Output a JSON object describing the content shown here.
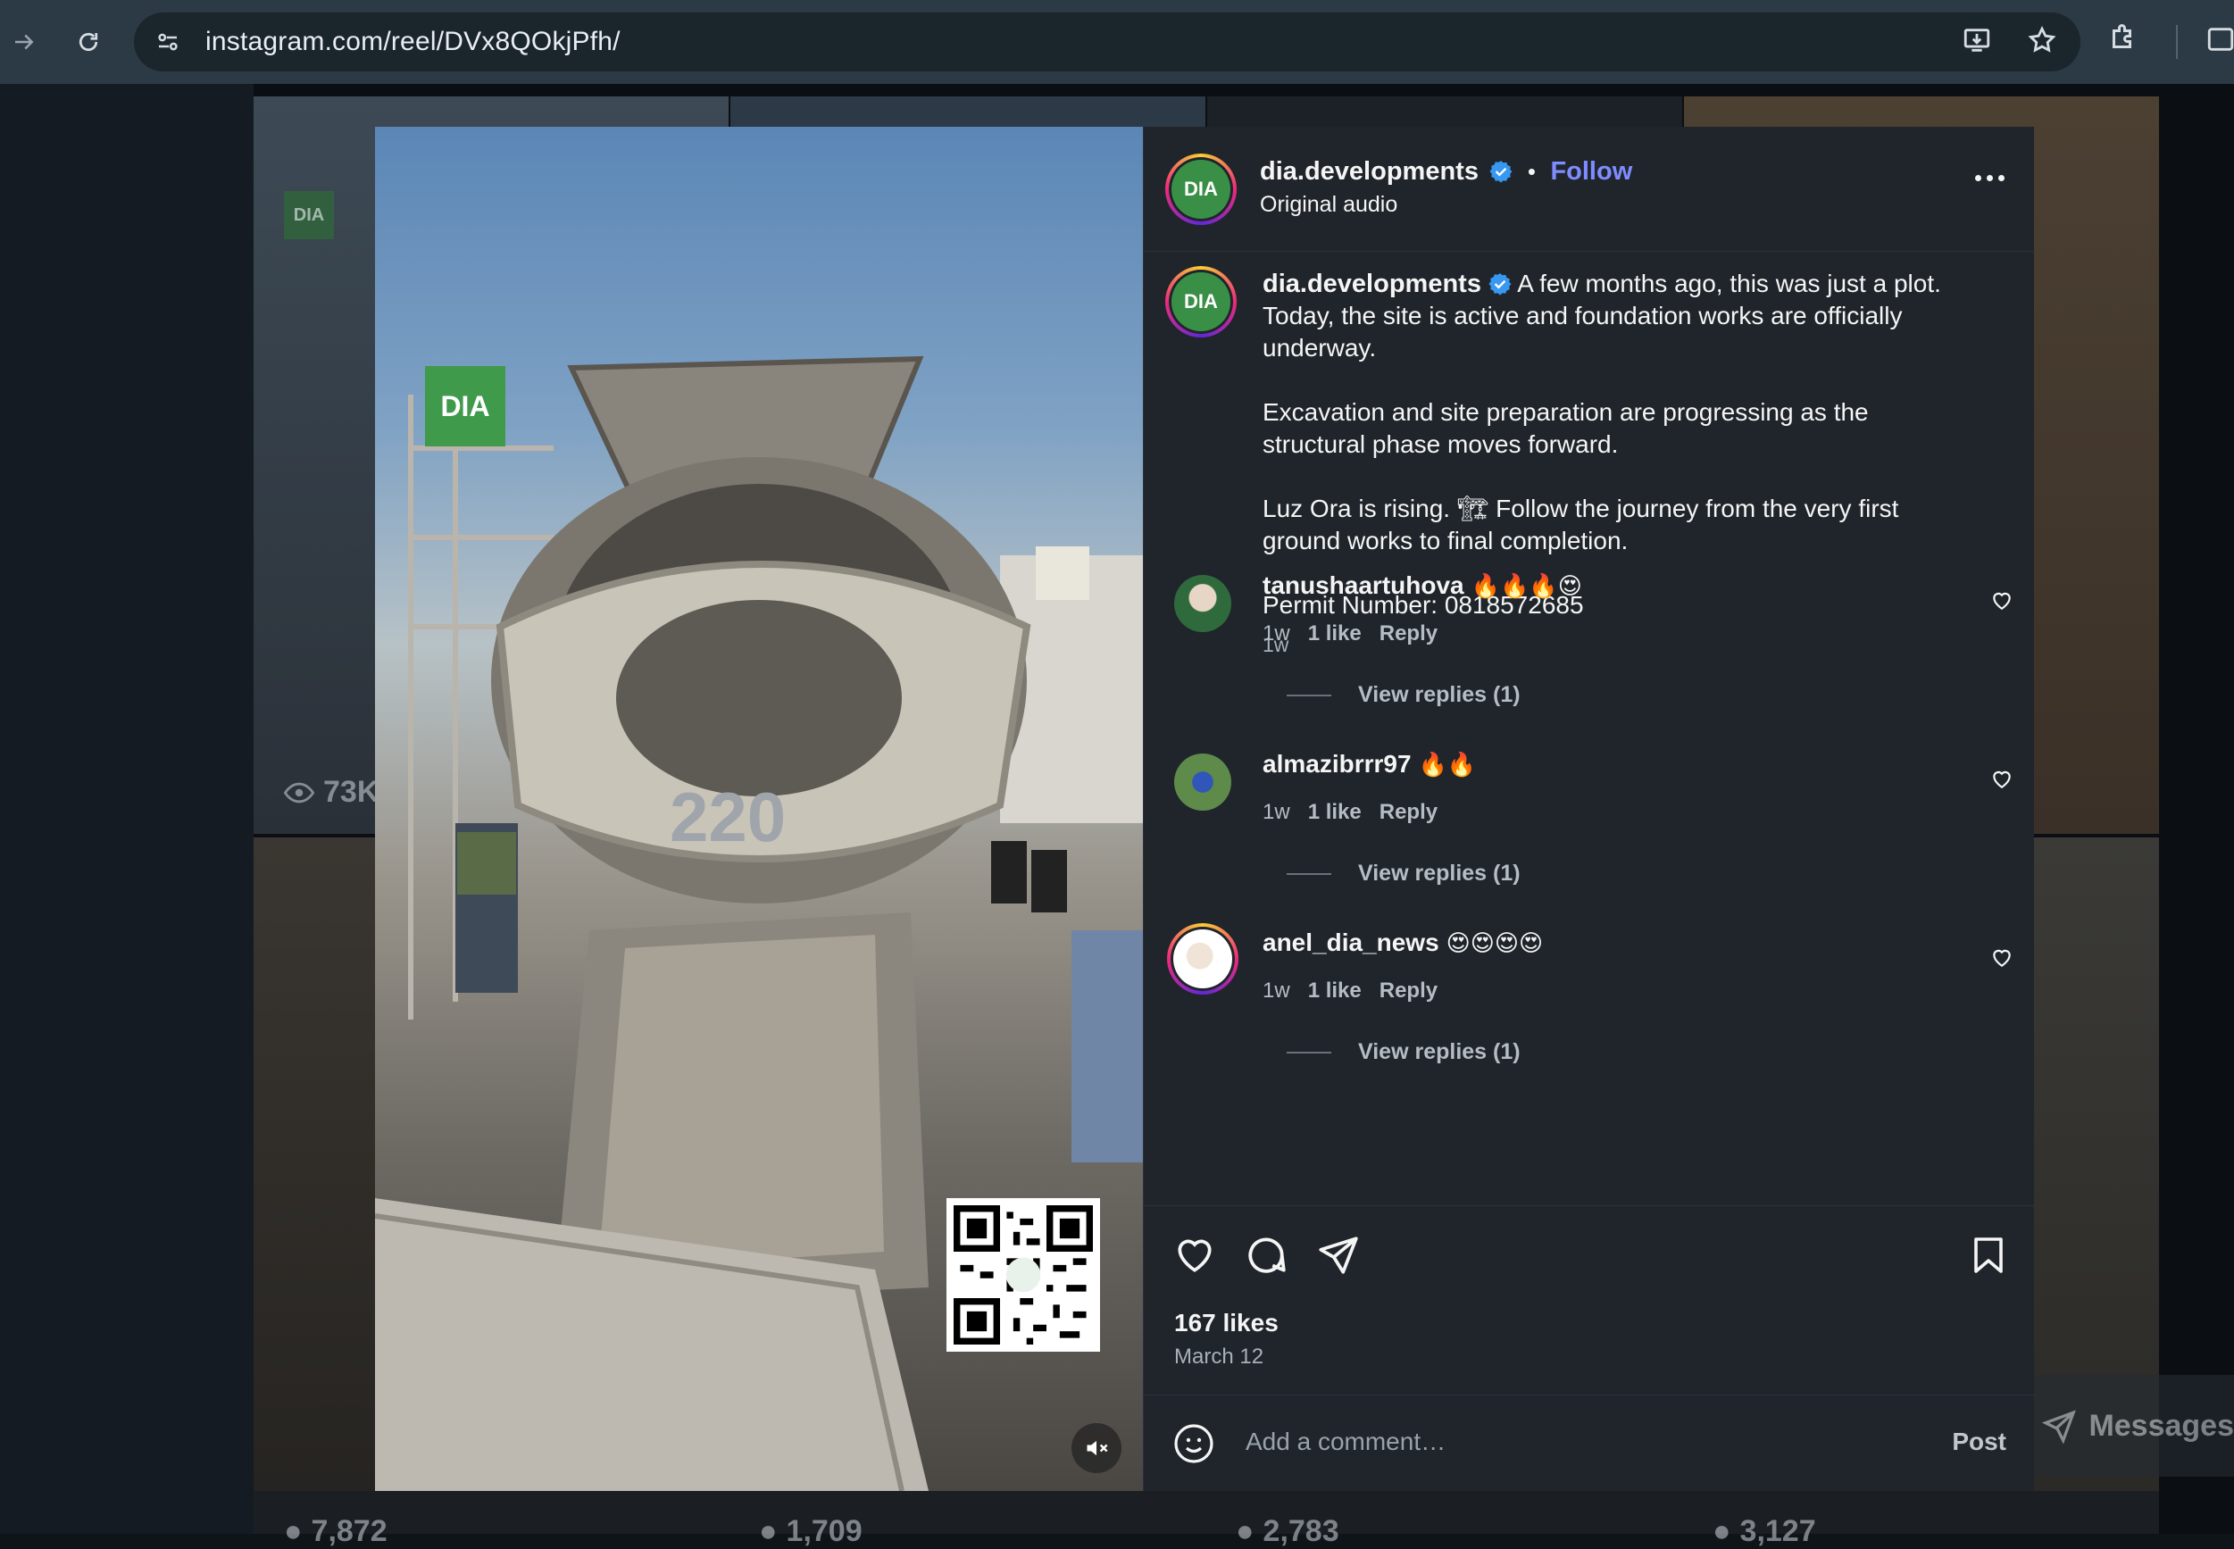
{
  "browser": {
    "url": "instagram.com/reel/DVx8QOkjPfh/"
  },
  "background": {
    "tile_views": [
      "73K",
      "7,872",
      "1,709",
      "2,783",
      "3,127"
    ],
    "tile_logo": "DIA",
    "messages_label": "Messages"
  },
  "media": {
    "logo_sign": "DIA",
    "drum_number": "220"
  },
  "post": {
    "author": {
      "username": "dia.developments",
      "verified": true,
      "follow_label": "Follow",
      "audio": "Original audio",
      "avatar_text": "DIA"
    },
    "caption": {
      "username": "dia.developments",
      "paragraphs": [
        "A few months ago, this was just a plot. Today, the site is active and foundation works are officially underway.",
        "Excavation and site preparation are progressing as the structural phase moves forward.",
        "Luz Ora is rising. 🏗 Follow the journey from the very first ground works to final completion.",
        "Permit Number: 0818572685"
      ],
      "time": "1w"
    },
    "comments": [
      {
        "username": "tanushaartuhova",
        "text": "🔥🔥🔥😍",
        "time": "1w",
        "likes": "1 like",
        "reply": "Reply",
        "view_replies": "View replies (1)"
      },
      {
        "username": "almazibrrr97",
        "text": "🔥🔥",
        "time": "1w",
        "likes": "1 like",
        "reply": "Reply",
        "view_replies": "View replies (1)"
      },
      {
        "username": "anel_dia_news",
        "text": "😍😍😍😍",
        "time": "1w",
        "likes": "1 like",
        "reply": "Reply",
        "view_replies": "View replies (1)"
      }
    ],
    "likes": "167 likes",
    "date": "March 12",
    "add_comment_placeholder": "Add a comment…",
    "post_label": "Post"
  },
  "colors": {
    "accent_link": "#7f8cff",
    "verified": "#3897f0",
    "brand_green": "#3a8f46"
  }
}
